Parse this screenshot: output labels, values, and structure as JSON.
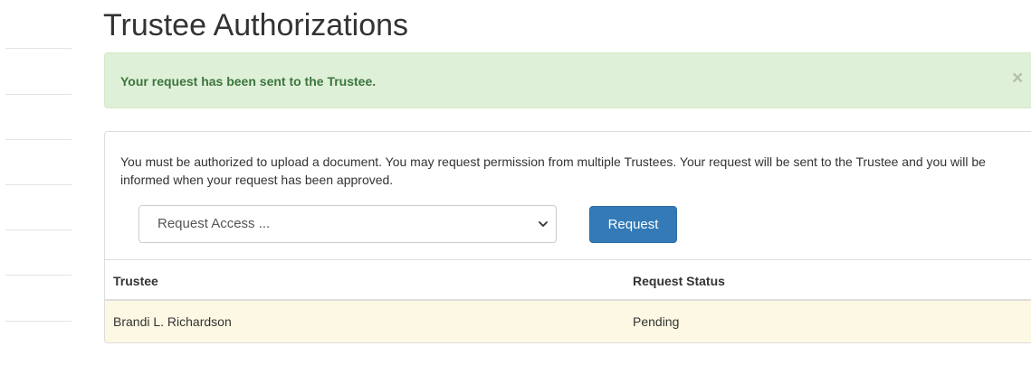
{
  "page": {
    "title": "Trustee Authorizations"
  },
  "alert": {
    "message": "Your request has been sent to the Trustee.",
    "close_glyph": "×",
    "status_color": "#3c763d",
    "background_color": "#dff0d8"
  },
  "request_panel": {
    "description": "You must be authorized to upload a document. You may request permission from multiple Trustees. Your request will be sent to the Trustee and you will be informed when your request has been approved.",
    "select": {
      "selected_value": "Request Access ...",
      "icon": "chevron-down-icon"
    },
    "request_button_label": "Request",
    "accent_color": "#337ab7"
  },
  "authorizations_table": {
    "columns": [
      "Trustee",
      "Request Status"
    ],
    "rows": [
      {
        "trustee": "Brandi L. Richardson",
        "status": "Pending"
      }
    ],
    "pending_row_color": "#fcf8e3"
  }
}
